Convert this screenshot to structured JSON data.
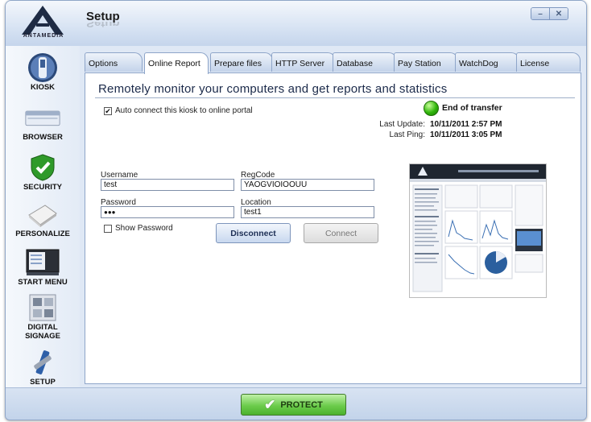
{
  "window": {
    "title": "Setup",
    "logo_text": "ANTAMEDIA",
    "minimize_glyph": "–",
    "close_glyph": "✕"
  },
  "sidebar": {
    "items": [
      {
        "label": "KIOSK",
        "icon": "kiosk-icon"
      },
      {
        "label": "BROWSER",
        "icon": "browser-icon"
      },
      {
        "label": "SECURITY",
        "icon": "shield-check-icon"
      },
      {
        "label": "PERSONALIZE",
        "icon": "personalize-icon"
      },
      {
        "label": "START MENU",
        "icon": "start-menu-icon"
      },
      {
        "label": "DIGITAL\nSIGNAGE",
        "icon": "digital-signage-icon"
      },
      {
        "label": "SETUP",
        "icon": "setup-tools-icon"
      }
    ]
  },
  "tabs": [
    {
      "label": "Options"
    },
    {
      "label": "Online Report",
      "active": true
    },
    {
      "label": "Prepare files"
    },
    {
      "label": "HTTP Server"
    },
    {
      "label": "Database"
    },
    {
      "label": "Pay Station"
    },
    {
      "label": "WatchDog"
    },
    {
      "label": "License"
    }
  ],
  "panel": {
    "heading": "Remotely monitor your computers and get reports and statistics",
    "auto_connect_label": "Auto connect this kiosk to online portal",
    "auto_connect_checked": true,
    "status": {
      "text": "End of transfer",
      "color": "#2fb50a"
    },
    "last_update_label": "Last Update:",
    "last_update_value": "10/11/2011 2:57 PM",
    "last_ping_label": "Last Ping:",
    "last_ping_value": "10/11/2011 3:05 PM",
    "username_label": "Username",
    "username_value": "test",
    "regcode_label": "RegCode",
    "regcode_value": "YAOGVIOIOOUU",
    "password_label": "Password",
    "password_value": "●●●",
    "location_label": "Location",
    "location_value": "test1",
    "show_password_label": "Show Password",
    "show_password_checked": false,
    "disconnect_label": "Disconnect",
    "connect_label": "Connect"
  },
  "footer": {
    "protect_label": "PROTECT",
    "protect_color": "#5fc23d"
  }
}
